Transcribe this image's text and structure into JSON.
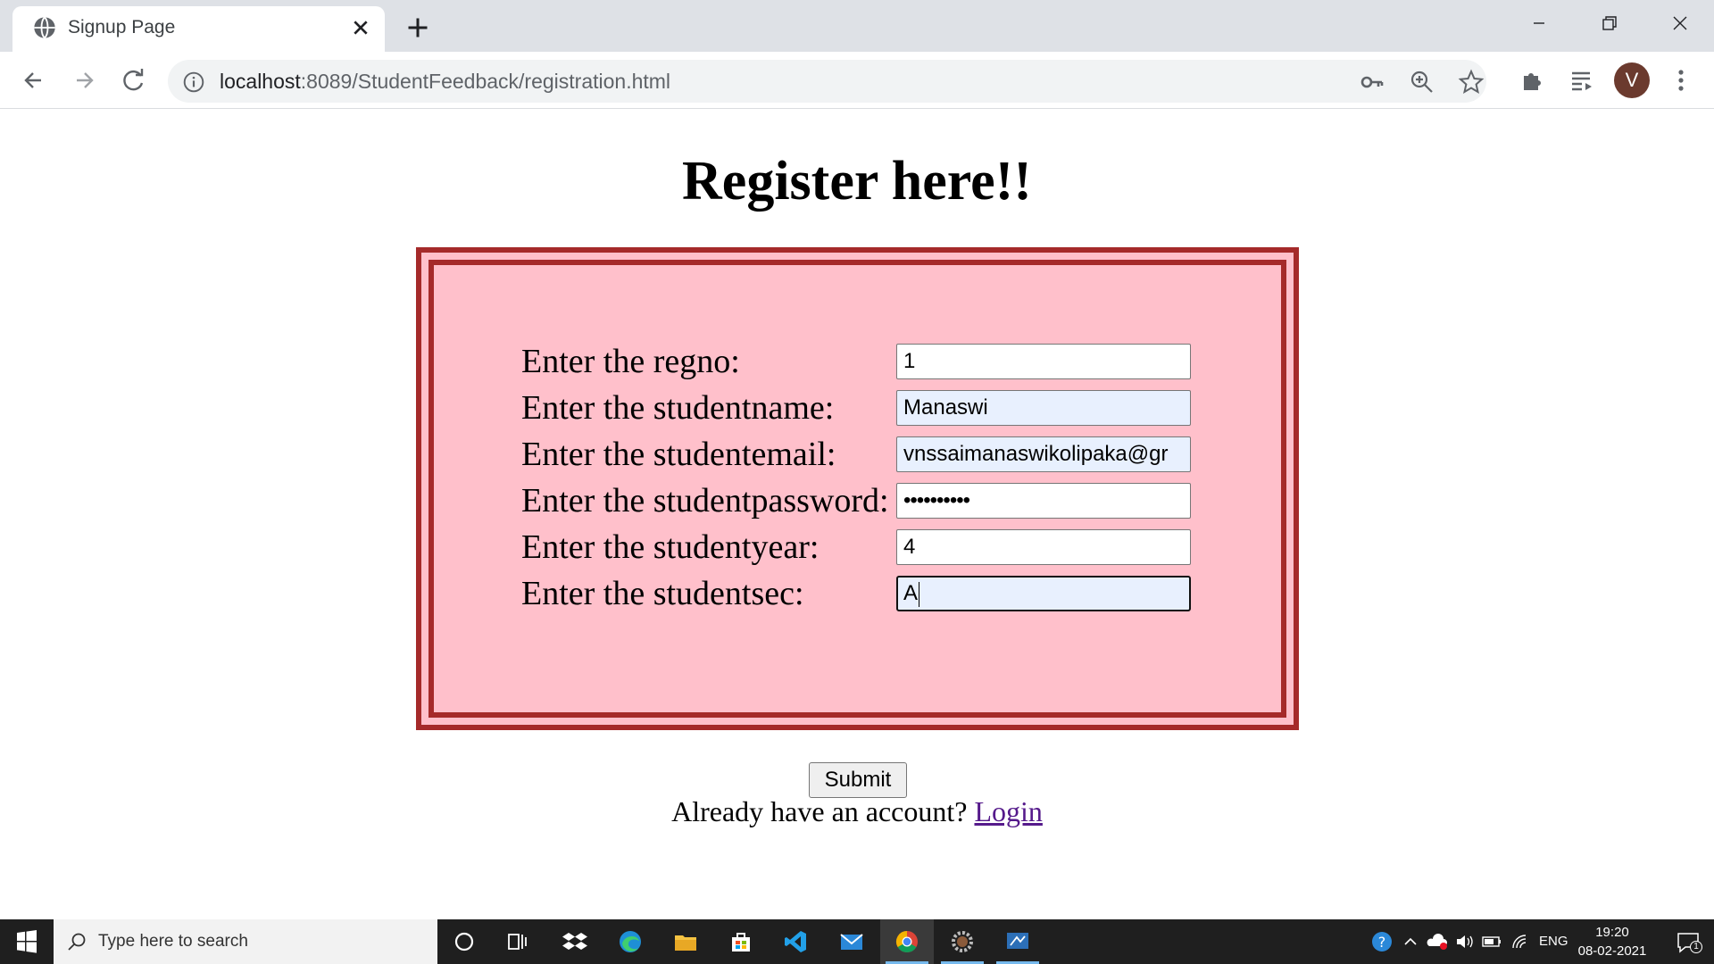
{
  "browser": {
    "tab_title": "Signup Page",
    "url_host": "localhost",
    "url_rest": ":8089/StudentFeedback/registration.html",
    "avatar_letter": "V"
  },
  "page": {
    "heading": "Register here!!",
    "fields": [
      {
        "label": "Enter the regno:",
        "value": "1"
      },
      {
        "label": "Enter the studentname:",
        "value": "Manaswi"
      },
      {
        "label": "Enter the studentemail:",
        "value": "vnssaimanaswikolipaka@gr"
      },
      {
        "label": "Enter the studentpassword:",
        "value": "••••••••••"
      },
      {
        "label": "Enter the studentyear:",
        "value": "4"
      },
      {
        "label": "Enter the studentsec:",
        "value": "A"
      }
    ],
    "submit_label": "Submit",
    "already_text": "Already have an account?",
    "login_link": "Login"
  },
  "colors": {
    "form_background": "#ffc0cb",
    "form_border": "#a52a2a",
    "autofill_background": "#e8f0fe",
    "link": "#551a8b"
  },
  "taskbar": {
    "search_placeholder": "Type here to search",
    "language": "ENG",
    "time": "19:20",
    "date": "08-02-2021",
    "notification_count": "1",
    "apps": [
      "cortana-icon",
      "task-view-icon",
      "dropbox-icon",
      "edge-icon",
      "file-explorer-icon",
      "store-icon",
      "vscode-icon",
      "mail-icon",
      "chrome-icon",
      "settings-app-icon",
      "remote-desktop-icon"
    ]
  }
}
